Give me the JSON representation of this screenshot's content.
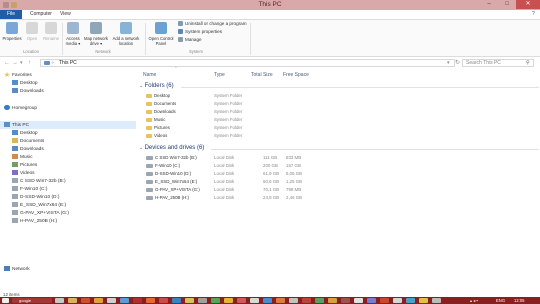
{
  "window": {
    "title": "This PC",
    "minimize": "–",
    "maximize": "□",
    "close": "✕",
    "help": "?"
  },
  "tabs": [
    {
      "label": "File"
    },
    {
      "label": "Computer"
    },
    {
      "label": "View"
    }
  ],
  "ribbon": {
    "buttons": [
      {
        "label": "Properties",
        "icon": "properties-icon"
      },
      {
        "label": "Open",
        "icon": "open-icon"
      },
      {
        "label": "Rename",
        "icon": "rename-icon"
      },
      {
        "label": "Access media ▾",
        "icon": "access-media-icon"
      },
      {
        "label": "Map network drive ▾",
        "icon": "map-drive-icon"
      },
      {
        "label": "Add a network location",
        "icon": "network-location-icon"
      },
      {
        "label": "Open Control Panel",
        "icon": "control-panel-icon"
      }
    ],
    "groups": {
      "location": "Location",
      "network": "Network",
      "system": "System"
    },
    "system_items": [
      "Uninstall or change a program",
      "System properties",
      "Manage"
    ]
  },
  "address": {
    "path": "This PC",
    "search_placeholder": "Search This PC"
  },
  "nav": {
    "favorites": "Favorites",
    "favorite_items": [
      "Desktop",
      "Downloads"
    ],
    "homegroup": "Homegroup",
    "this_pc": "This PC",
    "pc_items": [
      "Desktop",
      "Documents",
      "Downloads",
      "Music",
      "Pictures",
      "Videos",
      "C SSD Win7-32b (B:)",
      "F-Win10 (C:)",
      "D-SSD-Win10 (D:)",
      "E_SSD_Win7x64 (E:)",
      "G-PAV_XP+VISTA (G:)",
      "H-PAV_250B (H:)"
    ],
    "network": "Network"
  },
  "columns": {
    "name": "Name",
    "type": "Type",
    "total": "Total Size",
    "free": "Free Space"
  },
  "folders_header": "Folders (6)",
  "folders": [
    {
      "name": "Desktop",
      "type": "System Folder"
    },
    {
      "name": "Documents",
      "type": "System Folder"
    },
    {
      "name": "Downloads",
      "type": "System Folder"
    },
    {
      "name": "Music",
      "type": "System Folder"
    },
    {
      "name": "Pictures",
      "type": "System Folder"
    },
    {
      "name": "Videos",
      "type": "System Folder"
    }
  ],
  "drives_header": "Devices and drives (6)",
  "drives": [
    {
      "name": "C SSD Win7-32b (B:)",
      "type": "Local Disk",
      "total": "111 GB",
      "free": "833 MB"
    },
    {
      "name": "F-Win10 (C:)",
      "type": "Local Disk",
      "total": "200 GB",
      "free": "157 GB"
    },
    {
      "name": "D-SSD-Win10 (D:)",
      "type": "Local Disk",
      "total": "61,9 GB",
      "free": "5,06 GB"
    },
    {
      "name": "E_SSD_Win7x64 (E:)",
      "type": "Local Disk",
      "total": "50,6 GB",
      "free": "1,25 GB"
    },
    {
      "name": "G-PAV_XP+VISTA (G:)",
      "type": "Local Disk",
      "total": "70,1 GB",
      "free": "799 MB"
    },
    {
      "name": "H-PAV_250B (H:)",
      "type": "Local Disk",
      "total": "24,9 GB",
      "free": "2,46 GB"
    }
  ],
  "status": {
    "items": "12 items"
  },
  "taskbar": {
    "app": "google",
    "lang": "ENG",
    "time": "12:05"
  },
  "colors": {
    "titlebar": "#d9a9a9",
    "taskbar": "#8a1f1f",
    "accent": "#1e5ea8",
    "folder": "#e8c35b"
  }
}
